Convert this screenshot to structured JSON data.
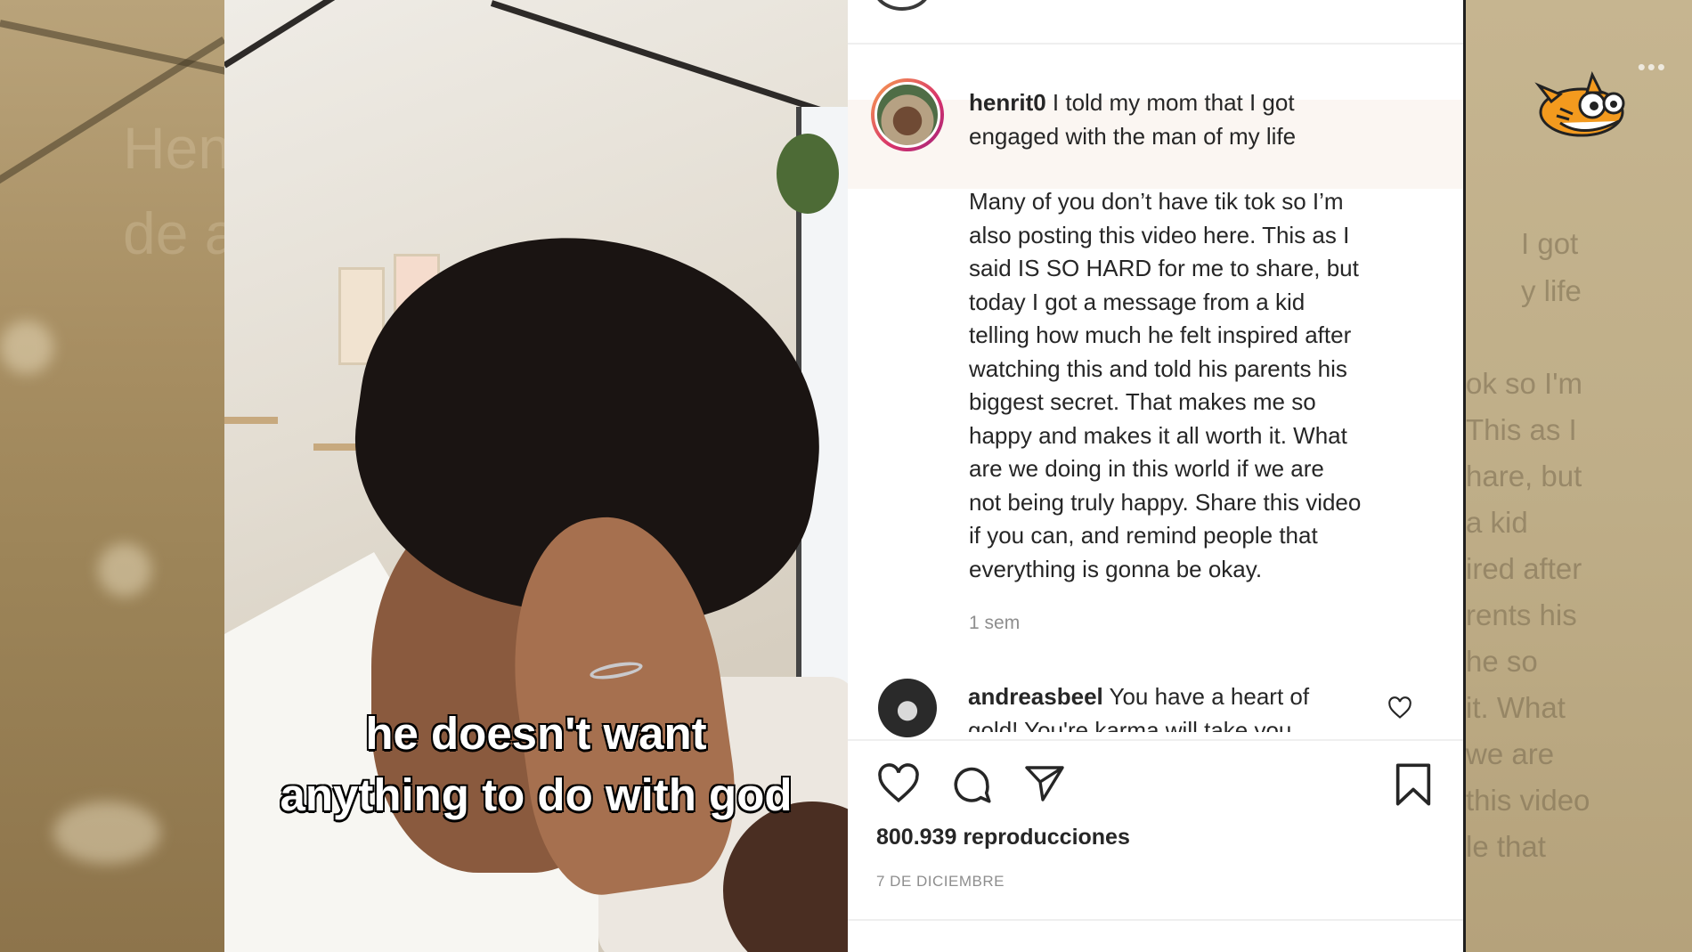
{
  "video": {
    "caption_line1": "he doesn't want",
    "caption_line2": "anything to do with god"
  },
  "background": {
    "ghost_left_line1": "Henry (orming Itora",
    "ghost_left_line2": "de a",
    "ghost_right": [
      "I got",
      "y life",
      "ok so I'm",
      "This as I",
      "hare, but",
      "a kid",
      "ired after",
      "rents his",
      "he so",
      "it. What",
      "we are",
      "this video",
      "le that"
    ],
    "menu_dots": "•••"
  },
  "post": {
    "username": "henrit0",
    "headline": "I told my mom that I got engaged with the man of my life",
    "headline_line1": "I told my mom that I got",
    "headline_line2": "engaged with the man of my life",
    "caption_lines": [
      "Many of you don’t have tik tok so I’m",
      "also posting this video here. This as I",
      "said IS SO HARD for me to share, but",
      "today I got a message from a kid",
      "telling how much he felt inspired after",
      "watching this and told his parents his",
      "biggest secret. That makes me so",
      "happy and makes it all worth it. What",
      "are we doing in this world if we are",
      "not being truly happy. Share this video",
      "if you can, and remind people that",
      "everything is gonna be okay."
    ],
    "time_ago": "1 sem",
    "comment": {
      "username": "andreasbeel",
      "line1": "You have a heart of",
      "line2": "gold! You're karma will take you"
    },
    "views": "800.939 reproducciones",
    "date": "7 DE DICIEMBRE"
  },
  "icons": {
    "like": "heart-icon",
    "comment": "comment-icon",
    "share": "send-icon",
    "save": "bookmark-icon",
    "comment_like": "heart-icon"
  },
  "colors": {
    "text": "#262626",
    "muted": "#8e8e8e",
    "avatar_ring_start": "#f9a14e",
    "avatar_ring_end": "#a1247c"
  }
}
